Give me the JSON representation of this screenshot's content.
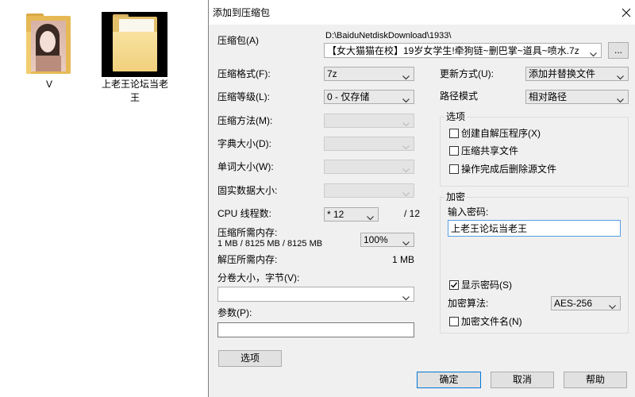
{
  "desktop": {
    "items": [
      {
        "label": "V",
        "icon": "folder-photo-icon"
      },
      {
        "label": "上老王论坛当老王",
        "icon": "folder-icon"
      }
    ]
  },
  "dialog": {
    "title": "添加到压缩包",
    "archive": {
      "label": "压缩包(A)",
      "folder_path": "D:\\BaiduNetdiskDownload\\1933\\",
      "filename": "【女大猫猫在校】19岁女学生!牵狗链~删巴掌~道具~喷水.7z",
      "browse_label": "..."
    },
    "settings": {
      "format": {
        "label": "压缩格式(F):",
        "value": "7z"
      },
      "level": {
        "label": "压缩等级(L):",
        "value": "0 - 仅存储"
      },
      "method": {
        "label": "压缩方法(M):"
      },
      "dictionary": {
        "label": "字典大小(D):"
      },
      "word_size": {
        "label": "单词大小(W):"
      },
      "solid_block": {
        "label": "固实数据大小:"
      },
      "threads": {
        "label": "CPU 线程数:",
        "value": "* 12",
        "max": "/ 12"
      },
      "compress_memory": {
        "label": "压缩所需内存:",
        "detail": "1 MB / 8125 MB / 8125 MB",
        "percent": "100%"
      },
      "decompress_memory": {
        "label": "解压所需内存:",
        "value": "1 MB"
      },
      "volume": {
        "label": "分卷大小，字节(V):",
        "value": ""
      },
      "parameters": {
        "label": "参数(P):",
        "value": ""
      },
      "options_button": "选项"
    },
    "update_mode": {
      "label": "更新方式(U):",
      "value": "添加并替换文件"
    },
    "path_mode": {
      "label": "路径模式",
      "value": "相对路径"
    },
    "options_group": {
      "title": "选项",
      "items": [
        {
          "label": "创建自解压程序(X)",
          "checked": false
        },
        {
          "label": "压缩共享文件",
          "checked": false
        },
        {
          "label": "操作完成后删除源文件",
          "checked": false
        }
      ]
    },
    "encryption": {
      "title": "加密",
      "password_label": "输入密码:",
      "password": "上老王论坛当老王",
      "show_password": {
        "label": "显示密码(S)",
        "checked": true
      },
      "method_label": "加密算法:",
      "method_value": "AES-256",
      "encrypt_names": {
        "label": "加密文件名(N)",
        "checked": false
      }
    },
    "buttons": {
      "ok": "确定",
      "cancel": "取消",
      "help": "帮助"
    }
  },
  "colors": {
    "accent": "#0078d7",
    "focus_border": "#569de5",
    "dialog_background": "#f0f0f0"
  },
  "icons": {
    "close": "close-icon",
    "dropdown": "chevron-down-icon",
    "checkbox_mark": "checkmark-icon"
  }
}
